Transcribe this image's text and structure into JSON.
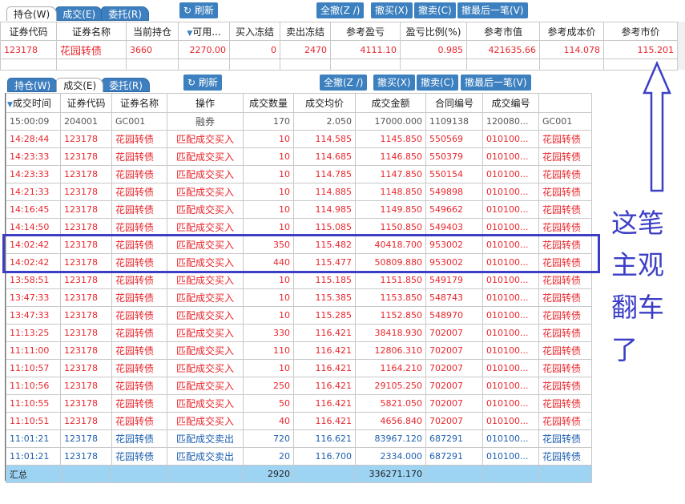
{
  "tabs": [
    "持仓(W)",
    "成交(E)",
    "委托(R)"
  ],
  "buttons": {
    "refresh": "刷新",
    "cancel_all": "全撤(Z /)",
    "cancel_buy": "撤买(X)",
    "cancel_sell": "撤卖(C)",
    "cancel_last": "撤最后一笔(V)"
  },
  "positions": {
    "headers": [
      "证券代码",
      "证券名称",
      "当前持仓",
      "可用...",
      "买入冻结",
      "卖出冻结",
      "参考盈亏",
      "盈亏比例(%)",
      "参考市值",
      "参考成本价",
      "参考市价"
    ],
    "rows": [
      [
        "123178",
        "花园转债",
        "3660",
        "2270.00",
        "0",
        "2470",
        "4111.10",
        "0.985",
        "421635.66",
        "114.078",
        "115.201"
      ]
    ]
  },
  "trades": {
    "headers": [
      "成交时间",
      "证券代码",
      "证券名称",
      "操作",
      "成交数量",
      "成交均价",
      "成交金额",
      "合同编号",
      "成交编号",
      ""
    ],
    "rows": [
      [
        "15:00:09",
        "204001",
        "GC001",
        "融券",
        "170",
        "2.050",
        "17000.000",
        "1109138",
        "120080...",
        "GC001"
      ],
      [
        "14:28:44",
        "123178",
        "花园转债",
        "匹配成交买入",
        "10",
        "114.585",
        "1145.850",
        "550569",
        "010100...",
        "花园转债"
      ],
      [
        "14:23:33",
        "123178",
        "花园转债",
        "匹配成交买入",
        "10",
        "114.685",
        "1146.850",
        "550379",
        "010100...",
        "花园转债"
      ],
      [
        "14:23:33",
        "123178",
        "花园转债",
        "匹配成交买入",
        "10",
        "114.785",
        "1147.850",
        "550154",
        "010100...",
        "花园转债"
      ],
      [
        "14:21:33",
        "123178",
        "花园转债",
        "匹配成交买入",
        "10",
        "114.885",
        "1148.850",
        "549898",
        "010100...",
        "花园转债"
      ],
      [
        "14:16:45",
        "123178",
        "花园转债",
        "匹配成交买入",
        "10",
        "114.985",
        "1149.850",
        "549662",
        "010100...",
        "花园转债"
      ],
      [
        "14:14:50",
        "123178",
        "花园转债",
        "匹配成交买入",
        "10",
        "115.085",
        "1150.850",
        "549403",
        "010100...",
        "花园转债"
      ],
      [
        "14:02:42",
        "123178",
        "花园转债",
        "匹配成交买入",
        "350",
        "115.482",
        "40418.700",
        "953002",
        "010100...",
        "花园转债"
      ],
      [
        "14:02:42",
        "123178",
        "花园转债",
        "匹配成交买入",
        "440",
        "115.477",
        "50809.880",
        "953002",
        "010100...",
        "花园转债"
      ],
      [
        "13:58:51",
        "123178",
        "花园转债",
        "匹配成交买入",
        "10",
        "115.185",
        "1151.850",
        "549179",
        "010100...",
        "花园转债"
      ],
      [
        "13:47:33",
        "123178",
        "花园转债",
        "匹配成交买入",
        "10",
        "115.385",
        "1153.850",
        "548743",
        "010100...",
        "花园转债"
      ],
      [
        "13:47:33",
        "123178",
        "花园转债",
        "匹配成交买入",
        "10",
        "115.285",
        "1152.850",
        "548970",
        "010100...",
        "花园转债"
      ],
      [
        "11:13:25",
        "123178",
        "花园转债",
        "匹配成交买入",
        "330",
        "116.421",
        "38418.930",
        "702007",
        "010100...",
        "花园转债"
      ],
      [
        "11:11:00",
        "123178",
        "花园转债",
        "匹配成交买入",
        "110",
        "116.421",
        "12806.310",
        "702007",
        "010100...",
        "花园转债"
      ],
      [
        "11:10:57",
        "123178",
        "花园转债",
        "匹配成交买入",
        "10",
        "116.421",
        "1164.210",
        "702007",
        "010100...",
        "花园转债"
      ],
      [
        "11:10:56",
        "123178",
        "花园转债",
        "匹配成交买入",
        "250",
        "116.421",
        "29105.250",
        "702007",
        "010100...",
        "花园转债"
      ],
      [
        "11:10:55",
        "123178",
        "花园转债",
        "匹配成交买入",
        "50",
        "116.421",
        "5821.050",
        "702007",
        "010100...",
        "花园转债"
      ],
      [
        "11:10:51",
        "123178",
        "花园转债",
        "匹配成交买入",
        "40",
        "116.421",
        "4656.840",
        "702007",
        "010100...",
        "花园转债"
      ],
      [
        "11:01:21",
        "123178",
        "花园转债",
        "匹配成交卖出",
        "720",
        "116.621",
        "83967.120",
        "687291",
        "010100...",
        "花园转债"
      ],
      [
        "11:01:21",
        "123178",
        "花园转债",
        "匹配成交卖出",
        "20",
        "116.700",
        "2334.000",
        "687291",
        "010100...",
        "花园转债"
      ]
    ],
    "summary": {
      "label": "汇总",
      "quantity": "2920",
      "amount": "336271.170"
    }
  },
  "annotation": [
    "这笔",
    "主观",
    "翻车",
    "了"
  ],
  "colors": {
    "buy": "#e8262c",
    "sell": "#1d5fae",
    "accent": "#3d80bf",
    "highlight_box": "#3c3fc6"
  }
}
